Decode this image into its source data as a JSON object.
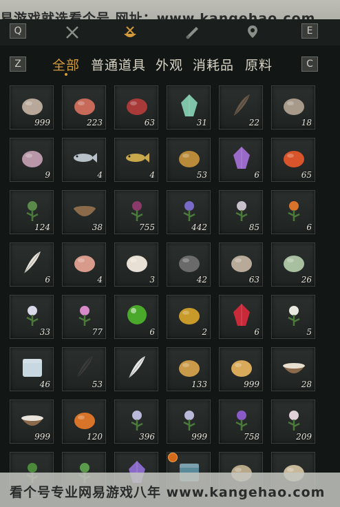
{
  "banner_top": "易游戏就选看个号  网址：www.kangehao.com",
  "keys": {
    "q": "Q",
    "e": "E",
    "z": "Z",
    "c": "C"
  },
  "tabs": [
    {
      "name": "weapons-tab-icon",
      "color": "#8a8e88"
    },
    {
      "name": "materials-tab-icon",
      "color": "#d49b3a",
      "active": true
    },
    {
      "name": "scroll-tab-icon",
      "color": "#8a8e88"
    },
    {
      "name": "location-tab-icon",
      "color": "#8a8e88"
    }
  ],
  "categories": [
    "全部",
    "普通道具",
    "外观",
    "消耗品",
    "原料"
  ],
  "items": [
    {
      "icon": "mushroom-icon",
      "color": "#b8a89a",
      "qty": "999"
    },
    {
      "icon": "raw-meat-icon",
      "color": "#c86a5a",
      "qty": "223"
    },
    {
      "icon": "steak-icon",
      "color": "#a83a3a",
      "qty": "63"
    },
    {
      "icon": "jade-stone-icon",
      "color": "#7fc4a8",
      "qty": "31"
    },
    {
      "icon": "feather-bundle-icon",
      "color": "#6a5a4a",
      "qty": "22"
    },
    {
      "icon": "fur-pelt-icon",
      "color": "#a89a8a",
      "qty": "18"
    },
    {
      "icon": "intestine-icon",
      "color": "#b898a8",
      "qty": "9"
    },
    {
      "icon": "fish-icon",
      "color": "#b8c0c8",
      "qty": "4"
    },
    {
      "icon": "golden-fish-icon",
      "color": "#c8a84a",
      "qty": "4"
    },
    {
      "icon": "ore-chunk-icon",
      "color": "#b88a3a",
      "qty": "53"
    },
    {
      "icon": "amethyst-icon",
      "color": "#9a6ac8",
      "qty": "6"
    },
    {
      "icon": "red-agate-icon",
      "color": "#d8542a",
      "qty": "65"
    },
    {
      "icon": "herb-plant-icon",
      "color": "#5a8a4a",
      "qty": "124"
    },
    {
      "icon": "herb-bowl-icon",
      "color": "#8a6a4a",
      "qty": "38"
    },
    {
      "icon": "purple-flower-icon",
      "color": "#8a3a6a",
      "qty": "755"
    },
    {
      "icon": "lavender-icon",
      "color": "#7a6ac8",
      "qty": "442"
    },
    {
      "icon": "white-blossom-icon",
      "color": "#c8c0c8",
      "qty": "85"
    },
    {
      "icon": "orange-flower-icon",
      "color": "#d8742a",
      "qty": "6"
    },
    {
      "icon": "white-feather-icon",
      "color": "#e8e4dc",
      "qty": "6"
    },
    {
      "icon": "meat-slice-icon",
      "color": "#d89a8a",
      "qty": "4"
    },
    {
      "icon": "wool-icon",
      "color": "#e8e0d4",
      "qty": "3"
    },
    {
      "icon": "iron-ore-icon",
      "color": "#6a6a6a",
      "qty": "42"
    },
    {
      "icon": "bone-icon",
      "color": "#b8aa98",
      "qty": "63"
    },
    {
      "icon": "gourd-icon",
      "color": "#a8c0a0",
      "qty": "26"
    },
    {
      "icon": "white-herb-icon",
      "color": "#d8d8e8",
      "qty": "33"
    },
    {
      "icon": "pink-herb-icon",
      "color": "#d88ac8",
      "qty": "77"
    },
    {
      "icon": "green-orb-icon",
      "color": "#4aa82a",
      "qty": "6"
    },
    {
      "icon": "gold-nugget-icon",
      "color": "#c89a2a",
      "qty": "2"
    },
    {
      "icon": "ruby-icon",
      "color": "#c82a3a",
      "qty": "6"
    },
    {
      "icon": "white-lily-icon",
      "color": "#e8e8e0",
      "qty": "5"
    },
    {
      "icon": "ice-flower-icon",
      "color": "#c8d8e0",
      "qty": "46"
    },
    {
      "icon": "black-feather-icon",
      "color": "#3a3a3a",
      "qty": "53"
    },
    {
      "icon": "fox-tail-icon",
      "color": "#e8e8e8",
      "qty": ""
    },
    {
      "icon": "bread-loaf-icon",
      "color": "#c89a4a",
      "qty": "133"
    },
    {
      "icon": "cake-icon",
      "color": "#d8aa5a",
      "qty": "999"
    },
    {
      "icon": "rice-bowl-icon",
      "color": "#e8e0d0",
      "qty": "28"
    },
    {
      "icon": "milk-bowl-icon",
      "color": "#e8e4dc",
      "qty": "999"
    },
    {
      "icon": "orange-fillet-icon",
      "color": "#d8742a",
      "qty": "120"
    },
    {
      "icon": "spider-lily-icon",
      "color": "#b8b8d8",
      "qty": "396"
    },
    {
      "icon": "spider-lily-icon",
      "color": "#b8b8d8",
      "qty": "999"
    },
    {
      "icon": "lupine-icon",
      "color": "#8a5ac8",
      "qty": "758"
    },
    {
      "icon": "peony-icon",
      "color": "#e0d0d8",
      "qty": "209"
    },
    {
      "icon": "fern-icon",
      "color": "#4a8a3a",
      "qty": ""
    },
    {
      "icon": "sprout-icon",
      "color": "#5a9a4a",
      "qty": ""
    },
    {
      "icon": "crystal-icon",
      "color": "#8a6ac8",
      "qty": ""
    },
    {
      "icon": "chest-icon",
      "color": "#5a8a9a",
      "qty": ""
    },
    {
      "icon": "scroll-icon",
      "color": "#b8a88a",
      "qty": ""
    },
    {
      "icon": "basket-icon",
      "color": "#c8b89a",
      "qty": ""
    }
  ],
  "banner_bottom": "看个号专业网易游戏八年  www.kangehao.com"
}
